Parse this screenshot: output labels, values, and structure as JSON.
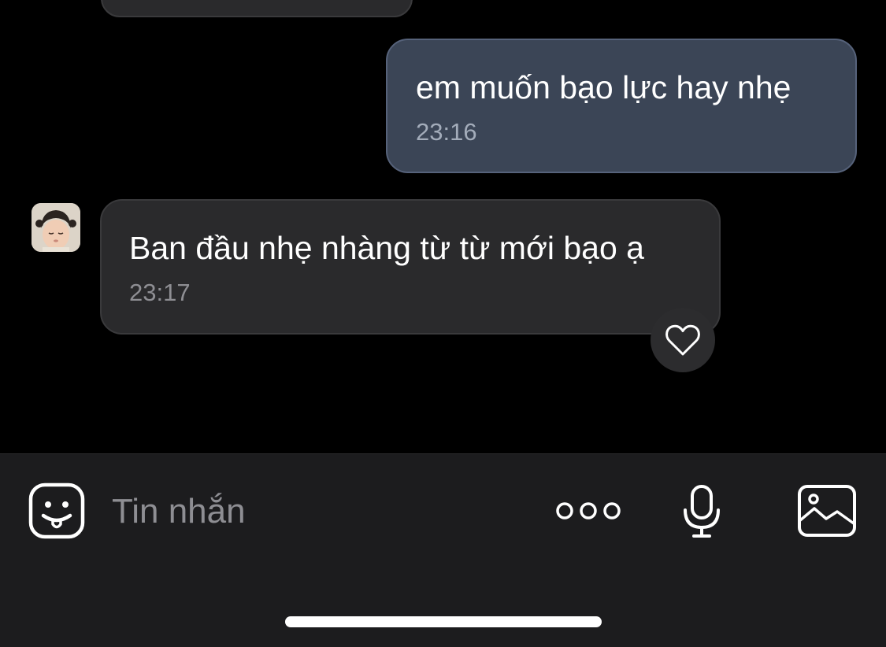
{
  "messages": [
    {
      "direction": "outgoing",
      "text": "em muốn bạo lực hay nhẹ",
      "time": "23:16"
    },
    {
      "direction": "incoming",
      "text": "Ban đầu nhẹ nhàng từ từ mới bạo ạ",
      "time": "23:17",
      "sender_avatar": "child-photo-avatar",
      "reaction_icon": "heart-icon"
    }
  ],
  "composer": {
    "placeholder": "Tin nhắn",
    "icons": [
      "sticker-icon",
      "more-icon",
      "mic-icon",
      "image-icon"
    ]
  },
  "colors": {
    "background": "#000000",
    "outgoing_bubble": "#3b4556",
    "incoming_bubble": "#2a2a2c",
    "composer_bar": "#1c1c1e"
  }
}
